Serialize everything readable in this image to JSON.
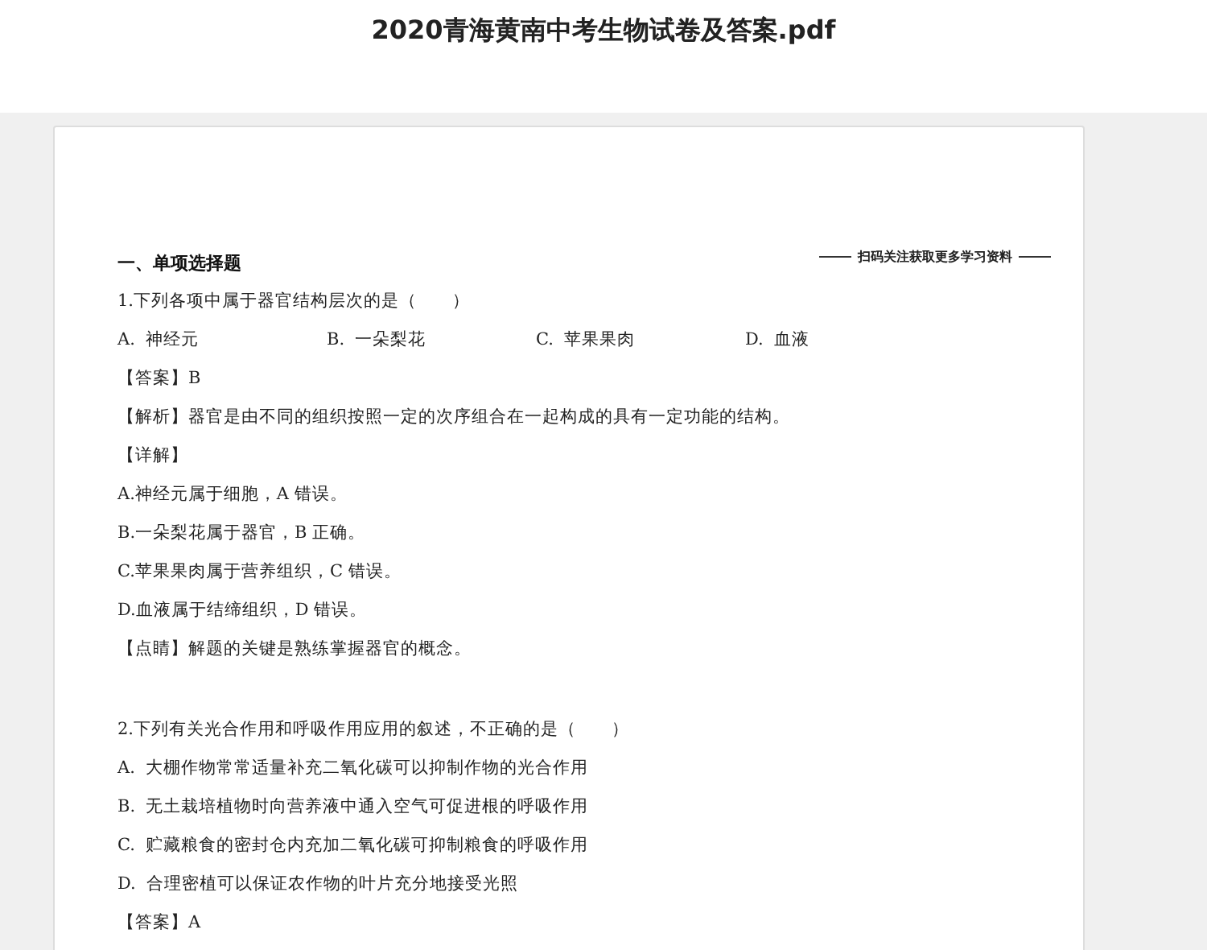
{
  "document_title": "2020青海黄南中考生物试卷及答案.pdf",
  "page": {
    "banner": "扫码关注获取更多学习资料",
    "section_heading": "一、单项选择题",
    "questions": [
      {
        "lines": [
          {
            "kind": "stem",
            "text": "1.下列各项中属于器官结构层次的是（　　）"
          },
          {
            "kind": "options_row",
            "options": [
              {
                "letter": "A.",
                "text": "神经元"
              },
              {
                "letter": "B.",
                "text": "一朵梨花"
              },
              {
                "letter": "C.",
                "text": "苹果果肉"
              },
              {
                "letter": "D.",
                "text": "血液"
              }
            ]
          },
          {
            "kind": "text",
            "text": "【答案】B"
          },
          {
            "kind": "text",
            "text": "【解析】器官是由不同的组织按照一定的次序组合在一起构成的具有一定功能的结构。"
          },
          {
            "kind": "text",
            "text": "【详解】"
          },
          {
            "kind": "text",
            "text": "A.神经元属于细胞，A 错误。"
          },
          {
            "kind": "text",
            "text": "B.一朵梨花属于器官，B 正确。"
          },
          {
            "kind": "text",
            "text": "C.苹果果肉属于营养组织，C 错误。"
          },
          {
            "kind": "text",
            "text": "D.血液属于结缔组织，D 错误。"
          },
          {
            "kind": "text",
            "text": "【点睛】解题的关键是熟练掌握器官的概念。"
          }
        ]
      },
      {
        "lines": [
          {
            "kind": "stem",
            "text": "2.下列有关光合作用和呼吸作用应用的叙述，不正确的是（　　）"
          },
          {
            "kind": "option",
            "letter": "A.",
            "text": "大棚作物常常适量补充二氧化碳可以抑制作物的光合作用"
          },
          {
            "kind": "option",
            "letter": "B.",
            "text": "无土栽培植物时向营养液中通入空气可促进根的呼吸作用"
          },
          {
            "kind": "option",
            "letter": "C.",
            "text": "贮藏粮食的密封仓内充加二氧化碳可抑制粮食的呼吸作用"
          },
          {
            "kind": "option",
            "letter": "D.",
            "text": "合理密植可以保证农作物的叶片充分地接受光照"
          },
          {
            "kind": "text",
            "text": "【答案】A"
          }
        ]
      }
    ]
  }
}
